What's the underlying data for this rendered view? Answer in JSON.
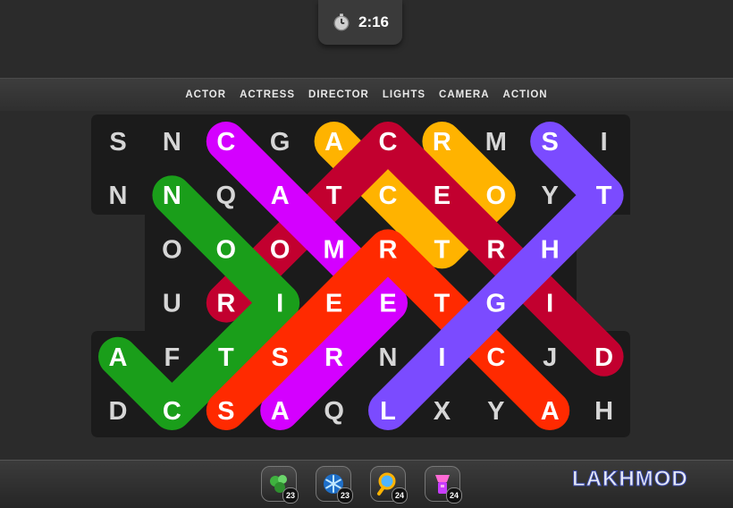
{
  "timer": {
    "icon": "stopwatch-icon",
    "value": "2:16"
  },
  "words": [
    "ACTOR",
    "ACTRESS",
    "DIRECTOR",
    "LIGHTS",
    "CAMERA",
    "ACTION"
  ],
  "grid": [
    [
      "S",
      "N",
      "C",
      "G",
      "A",
      "C",
      "R",
      "M",
      "S",
      "I"
    ],
    [
      "N",
      "N",
      "Q",
      "A",
      "T",
      "C",
      "E",
      "O",
      "Y",
      "T"
    ],
    [
      null,
      "O",
      "O",
      "O",
      "M",
      "R",
      "T",
      "R",
      "H",
      null
    ],
    [
      null,
      "U",
      "R",
      "I",
      "E",
      "E",
      "T",
      "G",
      "I",
      null
    ],
    [
      "A",
      "F",
      "T",
      "S",
      "R",
      "N",
      "I",
      "C",
      "J",
      "D"
    ],
    [
      "D",
      "C",
      "S",
      "A",
      "Q",
      "L",
      "X",
      "Y",
      "A",
      "H"
    ]
  ],
  "found_paths": [
    {
      "word": "ACTRESS",
      "color": "#ffb300",
      "cells": [
        [
          0,
          4
        ],
        [
          1,
          5
        ],
        [
          2,
          6
        ],
        [
          1,
          7
        ],
        [
          0,
          6
        ]
      ]
    },
    {
      "word": "DIRECTOR",
      "color": "#c2002f",
      "cells": [
        [
          4,
          9
        ],
        [
          0,
          5
        ],
        [
          3,
          2
        ]
      ]
    },
    {
      "word": "CAMERA",
      "color": "#d400ff",
      "cells": [
        [
          0,
          2
        ],
        [
          3,
          5
        ],
        [
          5,
          3
        ]
      ]
    },
    {
      "word": "ACTION",
      "color": "#1a9e1a",
      "cells": [
        [
          1,
          1
        ],
        [
          3,
          3
        ],
        [
          5,
          1
        ],
        [
          4,
          0
        ]
      ]
    },
    {
      "word": "ACTOR",
      "color": "#ff2a00",
      "cells": [
        [
          5,
          2
        ],
        [
          2,
          5
        ],
        [
          5,
          8
        ]
      ]
    },
    {
      "word": "LIGHTS",
      "color": "#7b4bff",
      "cells": [
        [
          5,
          5
        ],
        [
          1,
          9
        ],
        [
          0,
          8
        ]
      ]
    }
  ],
  "powerups": [
    {
      "name": "hint-cluster-powerup",
      "icon": "cluster-icon",
      "count": "23",
      "color": "#3fb23f"
    },
    {
      "name": "freeze-powerup",
      "icon": "snowflake-icon",
      "count": "23",
      "color": "#2fa8ff"
    },
    {
      "name": "magnifier-powerup",
      "icon": "magnifier-icon",
      "count": "24",
      "color": "#ffb300"
    },
    {
      "name": "flashlight-powerup",
      "icon": "flashlight-icon",
      "count": "24",
      "color": "#c93cff"
    }
  ],
  "watermark": "LAKHMOD"
}
